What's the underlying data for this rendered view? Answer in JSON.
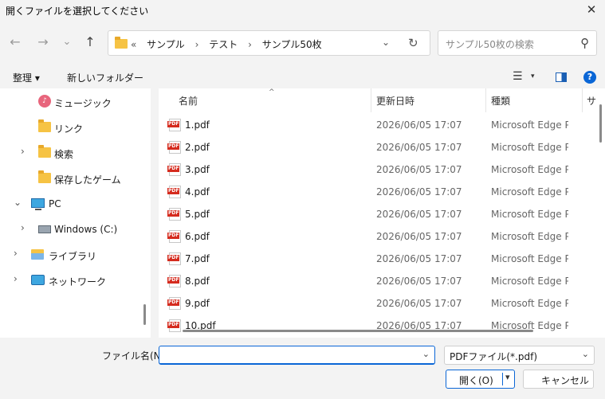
{
  "window": {
    "title": "開くファイルを選択してください",
    "close_glyph": "✕"
  },
  "nav_buttons": {
    "back": "←",
    "forward": "→",
    "recent": "⌄",
    "up": "↑"
  },
  "address": {
    "overflow": "«",
    "crumbs": [
      "サンプル",
      "テスト",
      "サンプル50枚"
    ],
    "separator": "›",
    "dropdown_glyph": "⌄",
    "refresh_glyph": "↻"
  },
  "search": {
    "placeholder": "サンプル50枚の検索",
    "icon": "search-icon",
    "icon_glyph": "⚲"
  },
  "toolbar": {
    "organize": "整理 ▾",
    "new_folder": "新しいフォルダー",
    "view_glyph": "☰",
    "view_dd": "▾",
    "help": "?"
  },
  "sidebar": {
    "items": [
      {
        "label": "ミュージック",
        "icon": "music-icon",
        "chevron": ""
      },
      {
        "label": "リンク",
        "icon": "folder-icon",
        "chevron": ""
      },
      {
        "label": "検索",
        "icon": "folder-icon",
        "chevron": "›"
      },
      {
        "label": "保存したゲーム",
        "icon": "folder-icon",
        "chevron": ""
      },
      {
        "label": "PC",
        "icon": "pc-icon",
        "chevron": "⌄"
      },
      {
        "label": "Windows (C:)",
        "icon": "drive-icon",
        "chevron": "›"
      },
      {
        "label": "ライブラリ",
        "icon": "library-icon",
        "chevron": "›"
      },
      {
        "label": "ネットワーク",
        "icon": "network-icon",
        "chevron": "›"
      }
    ]
  },
  "file_list": {
    "sort_caret": "^",
    "columns": {
      "name": "名前",
      "date": "更新日時",
      "type": "種類",
      "size": "サ"
    },
    "rows": [
      {
        "name": "1.pdf",
        "date": "2026/06/05 17:07",
        "type": "Microsoft Edge P..."
      },
      {
        "name": "2.pdf",
        "date": "2026/06/05 17:07",
        "type": "Microsoft Edge P..."
      },
      {
        "name": "3.pdf",
        "date": "2026/06/05 17:07",
        "type": "Microsoft Edge P..."
      },
      {
        "name": "4.pdf",
        "date": "2026/06/05 17:07",
        "type": "Microsoft Edge P..."
      },
      {
        "name": "5.pdf",
        "date": "2026/06/05 17:07",
        "type": "Microsoft Edge P..."
      },
      {
        "name": "6.pdf",
        "date": "2026/06/05 17:07",
        "type": "Microsoft Edge P..."
      },
      {
        "name": "7.pdf",
        "date": "2026/06/05 17:07",
        "type": "Microsoft Edge P..."
      },
      {
        "name": "8.pdf",
        "date": "2026/06/05 17:07",
        "type": "Microsoft Edge P..."
      },
      {
        "name": "9.pdf",
        "date": "2026/06/05 17:07",
        "type": "Microsoft Edge P..."
      },
      {
        "name": "10.pdf",
        "date": "2026/06/05 17:07",
        "type": "Microsoft Edge P..."
      }
    ]
  },
  "footer": {
    "filename_label": "ファイル名(N):",
    "filename_value": "",
    "filename_dd": "⌄",
    "filetype": "PDFファイル(*.pdf)",
    "filetype_dd": "⌄",
    "open": "開く(O)",
    "open_dd": "▾",
    "cancel": "キャンセル"
  },
  "colors": {
    "accent": "#0a66d6",
    "folder": "#f6c344",
    "pdf": "#d52b1e"
  }
}
